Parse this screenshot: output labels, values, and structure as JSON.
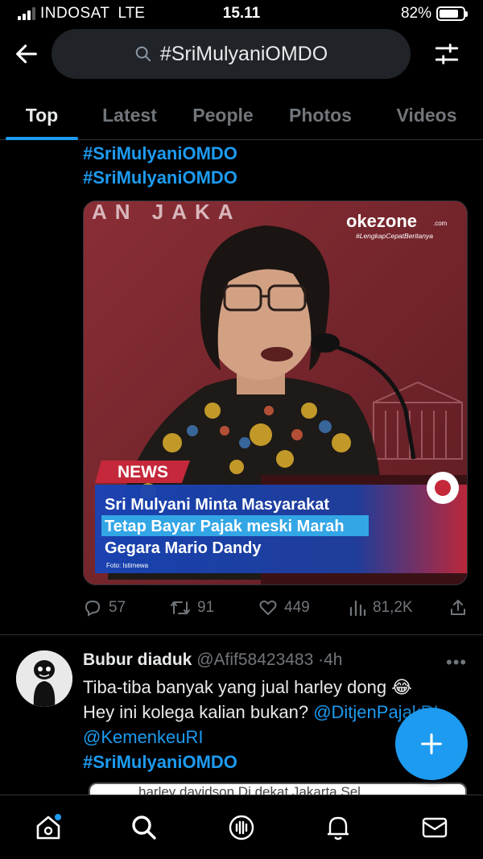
{
  "status": {
    "carrier": "INDOSAT",
    "network": "LTE",
    "time": "15.11",
    "battery": "82%",
    "battery_level": 0.82
  },
  "header": {
    "search_query": "#SriMulyaniOMDO"
  },
  "tabs": [
    {
      "label": "Top",
      "active": true
    },
    {
      "label": "Latest",
      "active": false
    },
    {
      "label": "People",
      "active": false
    },
    {
      "label": "Photos",
      "active": false
    },
    {
      "label": "Videos",
      "active": false
    }
  ],
  "tweet1": {
    "hashtags": [
      "#SriMulyaniOMDO",
      "#SriMulyaniOMDO"
    ],
    "media": {
      "background_text": "AN JAKA",
      "brand": "okezone",
      "brand_suffix": ".com",
      "brand_tagline": "#LengkapCepatBeritanya",
      "badge": "NEWS",
      "headline_lines": [
        "Sri Mulyani Minta Masyarakat",
        "Tetap Bayar Pajak meski Marah",
        "Gegara Mario Dandy"
      ],
      "credit": "Foto: Istimewa"
    },
    "stats": {
      "replies": "57",
      "retweets": "91",
      "likes": "449",
      "views": "81,2K"
    }
  },
  "tweet2": {
    "name": "Bubur diaduk",
    "handle": "@Afif58423483",
    "separator": "·",
    "time": "4h",
    "line1": "Tiba-tiba banyak yang jual harley dong 😂",
    "line2_text": "Hey ini kolega kalian bukan? ",
    "line2_link": "@DitjenPajakRI",
    "line3_link": "@KemenkeuRI",
    "hashtag": "#SriMulyaniOMDO",
    "preview_text": "harley davidson Di dekat Jakarta Sel"
  },
  "colors": {
    "accent": "#1d9bf0",
    "background": "#000000",
    "text": "#e7e9ea",
    "muted": "#71767b"
  }
}
